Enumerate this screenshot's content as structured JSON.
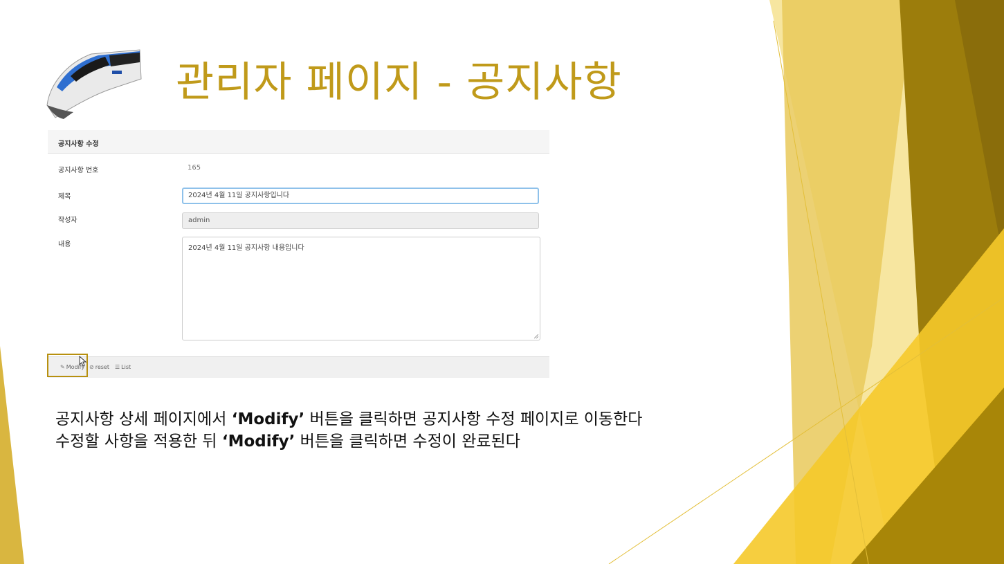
{
  "slide": {
    "title": "관리자 페이지 - 공지사항",
    "accent_color": "#c09a1a",
    "logo_icon": "ktx-train-icon"
  },
  "form": {
    "header": "공지사항 수정",
    "number_label": "공지사항 번호",
    "number_value": "165",
    "title_label": "제목",
    "title_value": "2024년 4월 11일 공지사항입니다",
    "writer_label": "작성자",
    "writer_value": "admin",
    "content_label": "내용",
    "content_value": "2024년 4월 11일 공지사항 내용입니다"
  },
  "footer": {
    "modify_label": "Modify",
    "modify_icon": "pencil-icon",
    "reset_label": "reset",
    "reset_icon": "ban-icon",
    "list_label": "List",
    "list_icon": "list-icon",
    "highlight_color": "#b7900f"
  },
  "description": {
    "line1_pre": "공지사항 상세 페이지에서 ",
    "line1_bold": "‘Modify’",
    "line1_post": " 버튼을 클릭하면 공지사항 수정 페이지로 이동한다",
    "line2_pre": "수정할 사항을 적용한 뒤 ",
    "line2_bold": "‘Modify’",
    "line2_post": " 버튼을 클릭하면 수정이 완료된다"
  },
  "theme": {
    "gold_light": "#f9e79a",
    "gold_mid": "#e6c13f",
    "gold_bright": "#f6cd2a",
    "gold_dark": "#a88608",
    "olive": "#8a6d0b"
  }
}
